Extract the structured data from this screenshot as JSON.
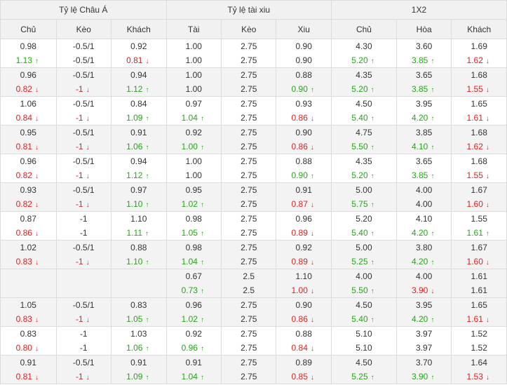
{
  "groups": [
    "Tỷ lệ Châu Á",
    "Tỷ lệ tài xiu",
    "1X2"
  ],
  "columns": [
    "Chủ",
    "Kèo",
    "Khách",
    "Tài",
    "Kèo",
    "Xiu",
    "Chủ",
    "Hòa",
    "Khách"
  ],
  "colors": {
    "up": "#27a51b",
    "down": "#e02020"
  },
  "rows": [
    [
      [
        {
          "v": "0.98",
          "d": "flat"
        },
        {
          "v": "1.13",
          "d": "up"
        }
      ],
      [
        {
          "v": "-0.5/1",
          "d": "flat"
        },
        {
          "v": "-0.5/1",
          "d": "flat"
        }
      ],
      [
        {
          "v": "0.92",
          "d": "flat"
        },
        {
          "v": "0.81",
          "d": "down"
        }
      ],
      [
        {
          "v": "1.00",
          "d": "flat"
        },
        {
          "v": "1.00",
          "d": "flat"
        }
      ],
      [
        {
          "v": "2.75",
          "d": "flat"
        },
        {
          "v": "2.75",
          "d": "flat"
        }
      ],
      [
        {
          "v": "0.90",
          "d": "flat"
        },
        {
          "v": "0.90",
          "d": "flat"
        }
      ],
      [
        {
          "v": "4.30",
          "d": "flat"
        },
        {
          "v": "5.20",
          "d": "up"
        }
      ],
      [
        {
          "v": "3.60",
          "d": "flat"
        },
        {
          "v": "3.85",
          "d": "up"
        }
      ],
      [
        {
          "v": "1.69",
          "d": "flat"
        },
        {
          "v": "1.62",
          "d": "down"
        }
      ]
    ],
    [
      [
        {
          "v": "0.96",
          "d": "flat"
        },
        {
          "v": "0.82",
          "d": "down"
        }
      ],
      [
        {
          "v": "-0.5/1",
          "d": "flat"
        },
        {
          "v": "-1",
          "d": "down"
        }
      ],
      [
        {
          "v": "0.94",
          "d": "flat"
        },
        {
          "v": "1.12",
          "d": "up"
        }
      ],
      [
        {
          "v": "1.00",
          "d": "flat"
        },
        {
          "v": "1.00",
          "d": "flat"
        }
      ],
      [
        {
          "v": "2.75",
          "d": "flat"
        },
        {
          "v": "2.75",
          "d": "flat"
        }
      ],
      [
        {
          "v": "0.88",
          "d": "flat"
        },
        {
          "v": "0.90",
          "d": "up"
        }
      ],
      [
        {
          "v": "4.35",
          "d": "flat"
        },
        {
          "v": "5.20",
          "d": "up"
        }
      ],
      [
        {
          "v": "3.65",
          "d": "flat"
        },
        {
          "v": "3.85",
          "d": "up"
        }
      ],
      [
        {
          "v": "1.68",
          "d": "flat"
        },
        {
          "v": "1.55",
          "d": "down"
        }
      ]
    ],
    [
      [
        {
          "v": "1.06",
          "d": "flat"
        },
        {
          "v": "0.84",
          "d": "down"
        }
      ],
      [
        {
          "v": "-0.5/1",
          "d": "flat"
        },
        {
          "v": "-1",
          "d": "down"
        }
      ],
      [
        {
          "v": "0.84",
          "d": "flat"
        },
        {
          "v": "1.09",
          "d": "up"
        }
      ],
      [
        {
          "v": "0.97",
          "d": "flat"
        },
        {
          "v": "1.04",
          "d": "up"
        }
      ],
      [
        {
          "v": "2.75",
          "d": "flat"
        },
        {
          "v": "2.75",
          "d": "flat"
        }
      ],
      [
        {
          "v": "0.93",
          "d": "flat"
        },
        {
          "v": "0.86",
          "d": "down"
        }
      ],
      [
        {
          "v": "4.50",
          "d": "flat"
        },
        {
          "v": "5.40",
          "d": "up"
        }
      ],
      [
        {
          "v": "3.95",
          "d": "flat"
        },
        {
          "v": "4.20",
          "d": "up"
        }
      ],
      [
        {
          "v": "1.65",
          "d": "flat"
        },
        {
          "v": "1.61",
          "d": "down"
        }
      ]
    ],
    [
      [
        {
          "v": "0.95",
          "d": "flat"
        },
        {
          "v": "0.81",
          "d": "down"
        }
      ],
      [
        {
          "v": "-0.5/1",
          "d": "flat"
        },
        {
          "v": "-1",
          "d": "down"
        }
      ],
      [
        {
          "v": "0.91",
          "d": "flat"
        },
        {
          "v": "1.06",
          "d": "up"
        }
      ],
      [
        {
          "v": "0.92",
          "d": "flat"
        },
        {
          "v": "1.00",
          "d": "up"
        }
      ],
      [
        {
          "v": "2.75",
          "d": "flat"
        },
        {
          "v": "2.75",
          "d": "flat"
        }
      ],
      [
        {
          "v": "0.90",
          "d": "flat"
        },
        {
          "v": "0.86",
          "d": "down"
        }
      ],
      [
        {
          "v": "4.75",
          "d": "flat"
        },
        {
          "v": "5.50",
          "d": "up"
        }
      ],
      [
        {
          "v": "3.85",
          "d": "flat"
        },
        {
          "v": "4.10",
          "d": "up"
        }
      ],
      [
        {
          "v": "1.68",
          "d": "flat"
        },
        {
          "v": "1.62",
          "d": "down"
        }
      ]
    ],
    [
      [
        {
          "v": "0.96",
          "d": "flat"
        },
        {
          "v": "0.82",
          "d": "down"
        }
      ],
      [
        {
          "v": "-0.5/1",
          "d": "flat"
        },
        {
          "v": "-1",
          "d": "down"
        }
      ],
      [
        {
          "v": "0.94",
          "d": "flat"
        },
        {
          "v": "1.12",
          "d": "up"
        }
      ],
      [
        {
          "v": "1.00",
          "d": "flat"
        },
        {
          "v": "1.00",
          "d": "flat"
        }
      ],
      [
        {
          "v": "2.75",
          "d": "flat"
        },
        {
          "v": "2.75",
          "d": "flat"
        }
      ],
      [
        {
          "v": "0.88",
          "d": "flat"
        },
        {
          "v": "0.90",
          "d": "up"
        }
      ],
      [
        {
          "v": "4.35",
          "d": "flat"
        },
        {
          "v": "5.20",
          "d": "up"
        }
      ],
      [
        {
          "v": "3.65",
          "d": "flat"
        },
        {
          "v": "3.85",
          "d": "up"
        }
      ],
      [
        {
          "v": "1.68",
          "d": "flat"
        },
        {
          "v": "1.55",
          "d": "down"
        }
      ]
    ],
    [
      [
        {
          "v": "0.93",
          "d": "flat"
        },
        {
          "v": "0.82",
          "d": "down"
        }
      ],
      [
        {
          "v": "-0.5/1",
          "d": "flat"
        },
        {
          "v": "-1",
          "d": "down"
        }
      ],
      [
        {
          "v": "0.97",
          "d": "flat"
        },
        {
          "v": "1.10",
          "d": "up"
        }
      ],
      [
        {
          "v": "0.95",
          "d": "flat"
        },
        {
          "v": "1.02",
          "d": "up"
        }
      ],
      [
        {
          "v": "2.75",
          "d": "flat"
        },
        {
          "v": "2.75",
          "d": "flat"
        }
      ],
      [
        {
          "v": "0.91",
          "d": "flat"
        },
        {
          "v": "0.87",
          "d": "down"
        }
      ],
      [
        {
          "v": "5.00",
          "d": "flat"
        },
        {
          "v": "5.75",
          "d": "up"
        }
      ],
      [
        {
          "v": "4.00",
          "d": "flat"
        },
        {
          "v": "4.00",
          "d": "flat"
        }
      ],
      [
        {
          "v": "1.67",
          "d": "flat"
        },
        {
          "v": "1.60",
          "d": "down"
        }
      ]
    ],
    [
      [
        {
          "v": "0.87",
          "d": "flat"
        },
        {
          "v": "0.86",
          "d": "down"
        }
      ],
      [
        {
          "v": "-1",
          "d": "flat"
        },
        {
          "v": "-1",
          "d": "flat"
        }
      ],
      [
        {
          "v": "1.10",
          "d": "flat"
        },
        {
          "v": "1.11",
          "d": "up"
        }
      ],
      [
        {
          "v": "0.98",
          "d": "flat"
        },
        {
          "v": "1.05",
          "d": "up"
        }
      ],
      [
        {
          "v": "2.75",
          "d": "flat"
        },
        {
          "v": "2.75",
          "d": "flat"
        }
      ],
      [
        {
          "v": "0.96",
          "d": "flat"
        },
        {
          "v": "0.89",
          "d": "down"
        }
      ],
      [
        {
          "v": "5.20",
          "d": "flat"
        },
        {
          "v": "5.40",
          "d": "up"
        }
      ],
      [
        {
          "v": "4.10",
          "d": "flat"
        },
        {
          "v": "4.20",
          "d": "up"
        }
      ],
      [
        {
          "v": "1.55",
          "d": "flat"
        },
        {
          "v": "1.61",
          "d": "up"
        }
      ]
    ],
    [
      [
        {
          "v": "1.02",
          "d": "flat"
        },
        {
          "v": "0.83",
          "d": "down"
        }
      ],
      [
        {
          "v": "-0.5/1",
          "d": "flat"
        },
        {
          "v": "-1",
          "d": "down"
        }
      ],
      [
        {
          "v": "0.88",
          "d": "flat"
        },
        {
          "v": "1.10",
          "d": "up"
        }
      ],
      [
        {
          "v": "0.98",
          "d": "flat"
        },
        {
          "v": "1.04",
          "d": "up"
        }
      ],
      [
        {
          "v": "2.75",
          "d": "flat"
        },
        {
          "v": "2.75",
          "d": "flat"
        }
      ],
      [
        {
          "v": "0.92",
          "d": "flat"
        },
        {
          "v": "0.89",
          "d": "down"
        }
      ],
      [
        {
          "v": "5.00",
          "d": "flat"
        },
        {
          "v": "5.25",
          "d": "up"
        }
      ],
      [
        {
          "v": "3.80",
          "d": "flat"
        },
        {
          "v": "4.20",
          "d": "up"
        }
      ],
      [
        {
          "v": "1.67",
          "d": "flat"
        },
        {
          "v": "1.60",
          "d": "down"
        }
      ]
    ],
    [
      [],
      [],
      [],
      [
        {
          "v": "0.67",
          "d": "flat"
        },
        {
          "v": "0.73",
          "d": "up"
        }
      ],
      [
        {
          "v": "2.5",
          "d": "flat"
        },
        {
          "v": "2.5",
          "d": "flat"
        }
      ],
      [
        {
          "v": "1.10",
          "d": "flat"
        },
        {
          "v": "1.00",
          "d": "down"
        }
      ],
      [
        {
          "v": "4.00",
          "d": "flat"
        },
        {
          "v": "5.50",
          "d": "up"
        }
      ],
      [
        {
          "v": "4.00",
          "d": "flat"
        },
        {
          "v": "3.90",
          "d": "down"
        }
      ],
      [
        {
          "v": "1.61",
          "d": "flat"
        },
        {
          "v": "1.61",
          "d": "flat"
        }
      ]
    ],
    [
      [
        {
          "v": "1.05",
          "d": "flat"
        },
        {
          "v": "0.83",
          "d": "down"
        }
      ],
      [
        {
          "v": "-0.5/1",
          "d": "flat"
        },
        {
          "v": "-1",
          "d": "down"
        }
      ],
      [
        {
          "v": "0.83",
          "d": "flat"
        },
        {
          "v": "1.05",
          "d": "up"
        }
      ],
      [
        {
          "v": "0.96",
          "d": "flat"
        },
        {
          "v": "1.02",
          "d": "up"
        }
      ],
      [
        {
          "v": "2.75",
          "d": "flat"
        },
        {
          "v": "2.75",
          "d": "flat"
        }
      ],
      [
        {
          "v": "0.90",
          "d": "flat"
        },
        {
          "v": "0.86",
          "d": "down"
        }
      ],
      [
        {
          "v": "4.50",
          "d": "flat"
        },
        {
          "v": "5.40",
          "d": "up"
        }
      ],
      [
        {
          "v": "3.95",
          "d": "flat"
        },
        {
          "v": "4.20",
          "d": "up"
        }
      ],
      [
        {
          "v": "1.65",
          "d": "flat"
        },
        {
          "v": "1.61",
          "d": "down"
        }
      ]
    ],
    [
      [
        {
          "v": "0.83",
          "d": "flat"
        },
        {
          "v": "0.80",
          "d": "down"
        }
      ],
      [
        {
          "v": "-1",
          "d": "flat"
        },
        {
          "v": "-1",
          "d": "flat"
        }
      ],
      [
        {
          "v": "1.03",
          "d": "flat"
        },
        {
          "v": "1.06",
          "d": "up"
        }
      ],
      [
        {
          "v": "0.92",
          "d": "flat"
        },
        {
          "v": "0.96",
          "d": "up"
        }
      ],
      [
        {
          "v": "2.75",
          "d": "flat"
        },
        {
          "v": "2.75",
          "d": "flat"
        }
      ],
      [
        {
          "v": "0.88",
          "d": "flat"
        },
        {
          "v": "0.84",
          "d": "down"
        }
      ],
      [
        {
          "v": "5.10",
          "d": "flat"
        },
        {
          "v": "5.10",
          "d": "flat"
        }
      ],
      [
        {
          "v": "3.97",
          "d": "flat"
        },
        {
          "v": "3.97",
          "d": "flat"
        }
      ],
      [
        {
          "v": "1.52",
          "d": "flat"
        },
        {
          "v": "1.52",
          "d": "flat"
        }
      ]
    ],
    [
      [
        {
          "v": "0.91",
          "d": "flat"
        },
        {
          "v": "0.81",
          "d": "down"
        }
      ],
      [
        {
          "v": "-0.5/1",
          "d": "flat"
        },
        {
          "v": "-1",
          "d": "down"
        }
      ],
      [
        {
          "v": "0.91",
          "d": "flat"
        },
        {
          "v": "1.09",
          "d": "up"
        }
      ],
      [
        {
          "v": "0.91",
          "d": "flat"
        },
        {
          "v": "1.04",
          "d": "up"
        }
      ],
      [
        {
          "v": "2.75",
          "d": "flat"
        },
        {
          "v": "2.75",
          "d": "flat"
        }
      ],
      [
        {
          "v": "0.89",
          "d": "flat"
        },
        {
          "v": "0.85",
          "d": "down"
        }
      ],
      [
        {
          "v": "4.50",
          "d": "flat"
        },
        {
          "v": "5.25",
          "d": "up"
        }
      ],
      [
        {
          "v": "3.70",
          "d": "flat"
        },
        {
          "v": "3.90",
          "d": "up"
        }
      ],
      [
        {
          "v": "1.64",
          "d": "flat"
        },
        {
          "v": "1.53",
          "d": "down"
        }
      ]
    ]
  ]
}
